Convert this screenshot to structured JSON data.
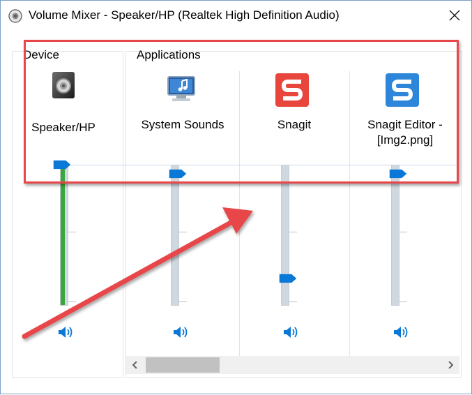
{
  "window": {
    "title": "Volume Mixer - Speaker/HP (Realtek High Definition Audio)"
  },
  "device_group": {
    "label": "Device",
    "name": "Speaker/HP",
    "volume_percent": 100,
    "peak_meter_percent": 100,
    "icon": "speaker-device-icon"
  },
  "applications_group": {
    "label": "Applications",
    "apps": [
      {
        "name": "System Sounds",
        "volume_percent": 94,
        "icon": "system-sounds-icon"
      },
      {
        "name": "Snagit",
        "volume_percent": 18,
        "icon": "snagit-icon"
      },
      {
        "name": "Snagit Editor - [Img2.png]",
        "line1": "Snagit Editor -",
        "line2": "[Img2.png]",
        "volume_percent": 94,
        "icon": "snagit-editor-icon"
      }
    ]
  },
  "colors": {
    "accent_blue": "#0a78d7",
    "meter_green": "#3aa63e",
    "annotation_red": "#e8474a",
    "snagit_red": "#e8453c",
    "snagit_editor_blue": "#2d86d9"
  },
  "scrollbar": {
    "left_arrow": "‹",
    "right_arrow": "›"
  }
}
